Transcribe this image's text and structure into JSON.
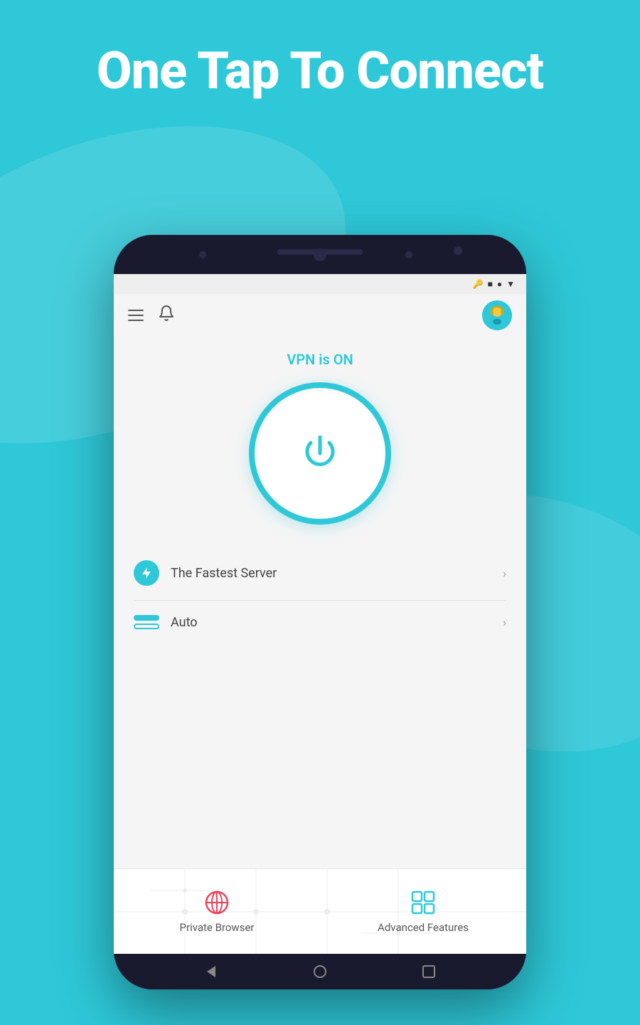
{
  "hero": {
    "title": "One Tap To Connect"
  },
  "statusBar": {
    "vpnKey": "⊙",
    "square": "■",
    "dot": "●",
    "signal": "▼"
  },
  "header": {
    "menuIcon": "menu",
    "bellIcon": "🔔",
    "avatarAlt": "support agent"
  },
  "vpn": {
    "statusText": "VPN is ON",
    "powerButton": "power"
  },
  "serverRow": {
    "label": "The Fastest Server",
    "chevron": "›"
  },
  "protocolRow": {
    "label": "Auto",
    "chevron": "›"
  },
  "bottomNav": {
    "privateBrowser": {
      "label": "Private Browser",
      "icon": "globe"
    },
    "advancedFeatures": {
      "label": "Advanced Features",
      "icon": "grid"
    }
  },
  "colors": {
    "accent": "#2ec8d8",
    "privateBrowserIcon": "#e8445a",
    "advancedFeaturesIcon": "#2ec8d8"
  }
}
